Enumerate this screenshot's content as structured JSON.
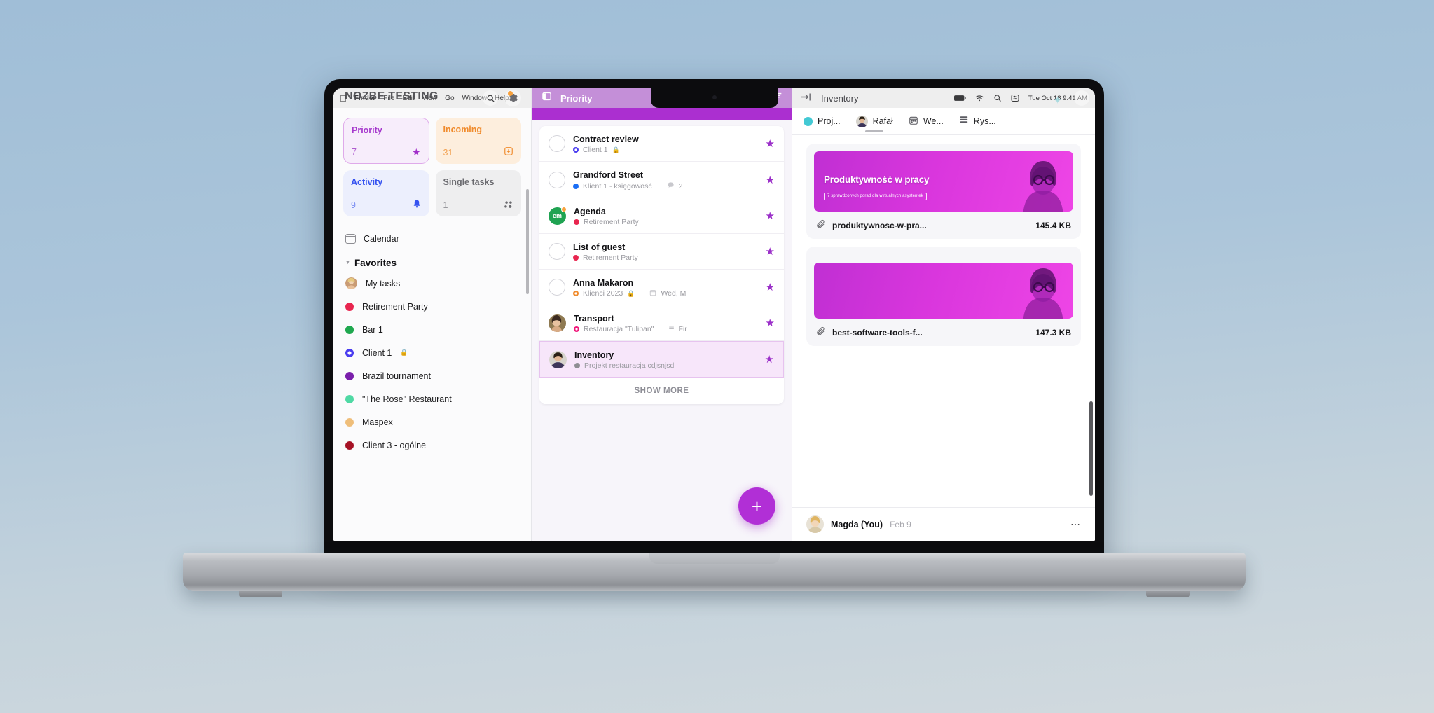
{
  "macos_menubar": {
    "apple": "apple-logo",
    "items": [
      "Finder",
      "File",
      "Edit",
      "View",
      "Go",
      "Window",
      "Help"
    ],
    "overlay_text": "NOZBE TESTING",
    "search_icon": "search-icon",
    "gear_icon": "gear-icon"
  },
  "sidebar": {
    "stats": [
      {
        "label": "Priority",
        "count": "7",
        "icon": "star-icon",
        "glyph": "★",
        "key": "priority"
      },
      {
        "label": "Incoming",
        "count": "31",
        "icon": "inbox-icon",
        "glyph": "⭳",
        "key": "incoming"
      },
      {
        "label": "Activity",
        "count": "9",
        "icon": "bell-icon",
        "glyph": "🔔",
        "key": "activity"
      },
      {
        "label": "Single tasks",
        "count": "1",
        "icon": "dots-icon",
        "glyph": "⁙",
        "key": "single"
      }
    ],
    "calendar": {
      "label": "Calendar",
      "icon": "calendar-icon"
    },
    "section_title": "Favorites",
    "favorites": [
      {
        "label": "My tasks",
        "type": "avatar",
        "color": "#d9a27a"
      },
      {
        "label": "Retirement Party",
        "type": "dot",
        "color": "#e8254f"
      },
      {
        "label": "Bar 1",
        "type": "dot",
        "color": "#1fa84f"
      },
      {
        "label": "Client 1",
        "type": "ring",
        "color": "#4a3df0",
        "locked": true
      },
      {
        "label": "Brazil tournament",
        "type": "dot",
        "color": "#7a1fab"
      },
      {
        "label": "\"The Rose\" Restaurant",
        "type": "dot",
        "color": "#4fd9a4"
      },
      {
        "label": "Maspex",
        "type": "dot",
        "color": "#efbe7a"
      },
      {
        "label": "Client 3 - ogólne",
        "type": "dot",
        "color": "#a61225"
      }
    ]
  },
  "tasks_panel": {
    "sidebar_toggle_icon": "panel-toggle-icon",
    "title": "Priority",
    "search_icon": "search-filter-icon",
    "items": [
      {
        "title": "Contract review",
        "lead": "checkbox",
        "project": "Client 1",
        "project_color": "#4a3df0",
        "project_type": "ring",
        "locked": true,
        "starred": true
      },
      {
        "title": "Grandford Street",
        "lead": "checkbox",
        "project": "Klient 1 - księgowość",
        "project_color": "#1a6ef5",
        "project_type": "dot",
        "comment_count": "2",
        "starred": true
      },
      {
        "title": "Agenda",
        "lead": "initials",
        "initials": "em",
        "avatar_color": "#1fa352",
        "badge": true,
        "project": "Retirement Party",
        "project_color": "#e8254f",
        "project_type": "dot",
        "starred": true
      },
      {
        "title": "List of guest",
        "lead": "checkbox",
        "project": "Retirement Party",
        "project_color": "#e8254f",
        "project_type": "dot",
        "starred": true
      },
      {
        "title": "Anna Makaron",
        "lead": "checkbox",
        "project": "Klienci 2023",
        "project_color": "#f08b2c",
        "project_type": "ring",
        "locked": true,
        "date": "Wed, M",
        "starred": true
      },
      {
        "title": "Transport",
        "lead": "photo",
        "avatar_color": "#7d5f4d",
        "project": "Restauracja \"Tulipan\"",
        "project_color": "#f0177a",
        "project_type": "ring",
        "extra": "Fir",
        "starred": true
      },
      {
        "title": "Inventory",
        "lead": "photo",
        "avatar_color": "#5b6b86",
        "project": "Projekt restauracja cdjsnjsd",
        "project_color": "#8e8e93",
        "project_type": "dot",
        "starred": true,
        "selected": true
      }
    ],
    "show_more": "SHOW MORE",
    "add_button": "+"
  },
  "detail_panel": {
    "collapse_icon": "collapse-right-icon",
    "title": "Inventory",
    "status_icons": [
      "battery-icon",
      "wifi-icon",
      "search-icon",
      "control-center-icon"
    ],
    "status_time": "Tue Oct 18  9:41 AM",
    "tabs": [
      {
        "label": "Proj...",
        "icon_type": "dot",
        "color": "#43c9d4",
        "active": false
      },
      {
        "label": "Rafał",
        "icon_type": "avatar",
        "color": "#5b6b86",
        "active": true
      },
      {
        "label": "We...",
        "icon_type": "calendar",
        "active": false
      },
      {
        "label": "Rys...",
        "icon_type": "list",
        "active": false
      }
    ],
    "attachments": [
      {
        "thumb_title": "Produktywność w pracy",
        "thumb_subtitle": "7 sprawdzonych porad dla wirtualnych asystentek",
        "file_name": "produktywnosc-w-pra...",
        "file_size": "145.4 KB",
        "clip_icon": "paperclip-icon"
      },
      {
        "thumb_title": "",
        "thumb_subtitle": "",
        "file_name": "best-software-tools-f...",
        "file_size": "147.3 KB",
        "clip_icon": "paperclip-icon"
      }
    ],
    "comment": {
      "author": "Magda (You)",
      "date": "Feb 9",
      "more_icon": "more-horizontal-icon"
    }
  }
}
